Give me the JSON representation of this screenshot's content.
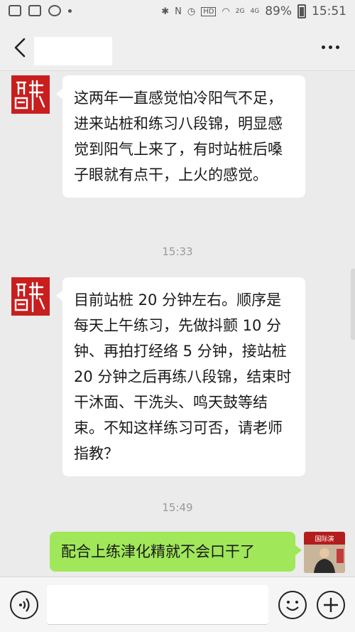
{
  "statusbar": {
    "battery": "89%",
    "time": "15:51",
    "hd": "HD",
    "network_a": "2G",
    "network_b": "4G"
  },
  "nav": {
    "back_icon": "chevron-left-icon",
    "more_icon": "more-dots-icon"
  },
  "messages": [
    {
      "sender": "other",
      "text": "这两年一直感觉怕冷阳气不足，进来站桩和练习八段锦，明显感觉到阳气上来了，有时站桩后嗓子眼就有点干，上火的感觉。"
    },
    {
      "type": "time",
      "text": "15:33"
    },
    {
      "sender": "other",
      "text": "目前站桩 20 分钟左右。顺序是每天上午练习，先做抖颤 10 分钟、再拍打经络 5 分钟，接站桩 20 分钟之后再练八段锦，结束时干沐面、干洗头、鸣天鼓等结束。不知这样练习可否，请老师指教？"
    },
    {
      "type": "time",
      "text": "15:49"
    },
    {
      "sender": "me",
      "text": "配合上练津化精就不会口干了"
    }
  ],
  "avatar_banner_text": "国际演",
  "inputbar": {
    "voice_icon": "voice-icon",
    "emoji_icon": "emoji-icon",
    "plus_icon": "plus-icon"
  },
  "colors": {
    "self_bubble": "#a0e75a",
    "seal_red": "#c81e1e"
  }
}
